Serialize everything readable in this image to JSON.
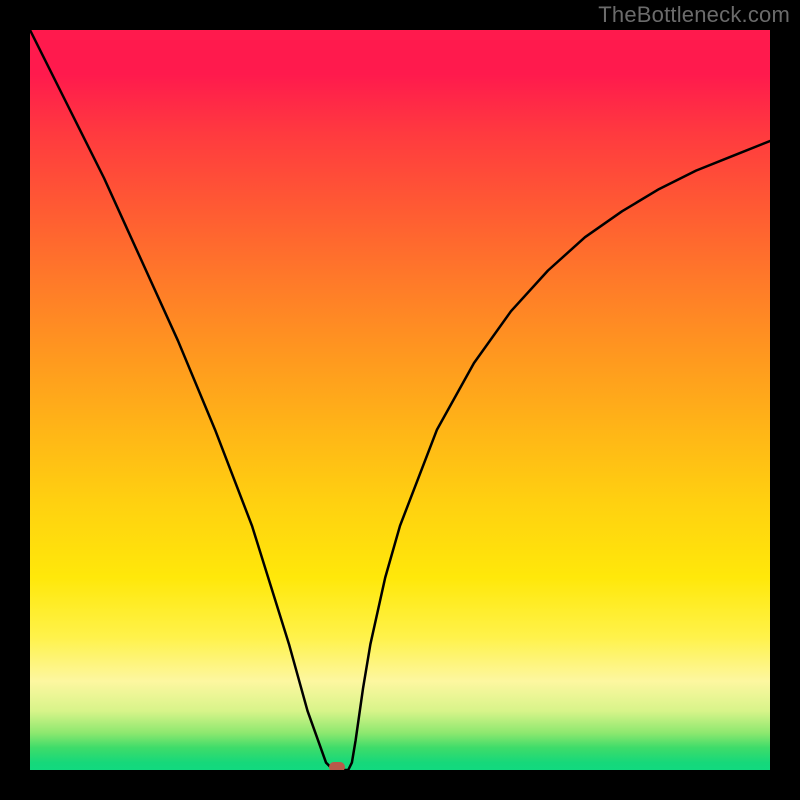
{
  "watermark": "TheBottleneck.com",
  "colors": {
    "frame_bg": "#000000",
    "marker": "#b85a4a",
    "curve": "#000000",
    "gradient_top": "#ff1a4d",
    "gradient_bottom": "#12d97f"
  },
  "chart_data": {
    "type": "line",
    "title": "",
    "xlabel": "",
    "ylabel": "",
    "xlim": [
      0,
      100
    ],
    "ylim": [
      0,
      100
    ],
    "x": [
      0,
      5,
      10,
      15,
      20,
      25,
      30,
      32.5,
      35,
      37.5,
      40,
      41,
      42,
      43,
      43.5,
      44,
      45,
      46,
      48,
      50,
      55,
      60,
      65,
      70,
      75,
      80,
      85,
      90,
      95,
      100
    ],
    "values": [
      100,
      90,
      80,
      69,
      58,
      46,
      33,
      25,
      17,
      8,
      1,
      0,
      0,
      0,
      1,
      4,
      11,
      17,
      26,
      33,
      46,
      55,
      62,
      67.5,
      72,
      75.5,
      78.5,
      81,
      83,
      85
    ],
    "marker": {
      "x": 41.5,
      "y": 0
    },
    "notes": "Y axis represents bottleneck percentage (100 at top, 0 at bottom). Background gradient encodes severity: red at top (high bottleneck) through orange/yellow to green at bottom (no bottleneck). Curve shows a V-shape with minimum near x≈41.5 where a small marker sits."
  }
}
